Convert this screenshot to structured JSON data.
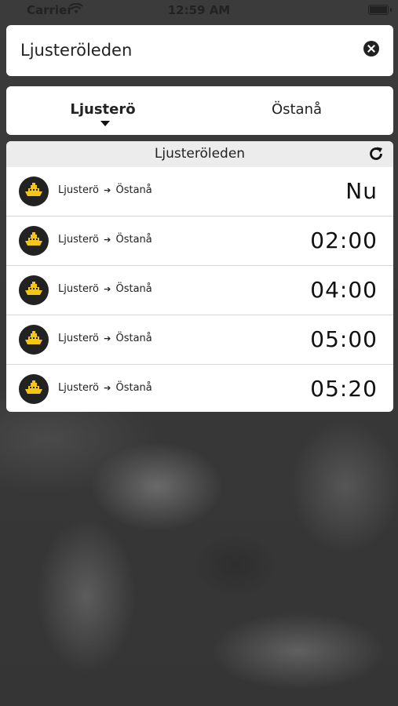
{
  "status_bar": {
    "carrier": "Carrier",
    "time": "12:59 AM"
  },
  "search": {
    "value": "Ljusteröleden"
  },
  "direction": {
    "from": "Ljusterö",
    "to": "Östanå",
    "active": "from"
  },
  "list": {
    "title": "Ljusteröleden",
    "rows": [
      {
        "from": "Ljusterö",
        "arrow": "➔",
        "to": "Östanå",
        "time": "Nu"
      },
      {
        "from": "Ljusterö",
        "arrow": "➔",
        "to": "Östanå",
        "time": "02:00"
      },
      {
        "from": "Ljusterö",
        "arrow": "➔",
        "to": "Östanå",
        "time": "04:00"
      },
      {
        "from": "Ljusterö",
        "arrow": "➔",
        "to": "Östanå",
        "time": "05:00"
      },
      {
        "from": "Ljusterö",
        "arrow": "➔",
        "to": "Östanå",
        "time": "05:20"
      }
    ]
  },
  "icons": {
    "clear": "close-circle-icon",
    "refresh": "refresh-icon",
    "ferry": "ferry-icon"
  },
  "colors": {
    "ferry_yellow": "#f5c518",
    "card": "#ffffff",
    "header": "#ececec"
  }
}
